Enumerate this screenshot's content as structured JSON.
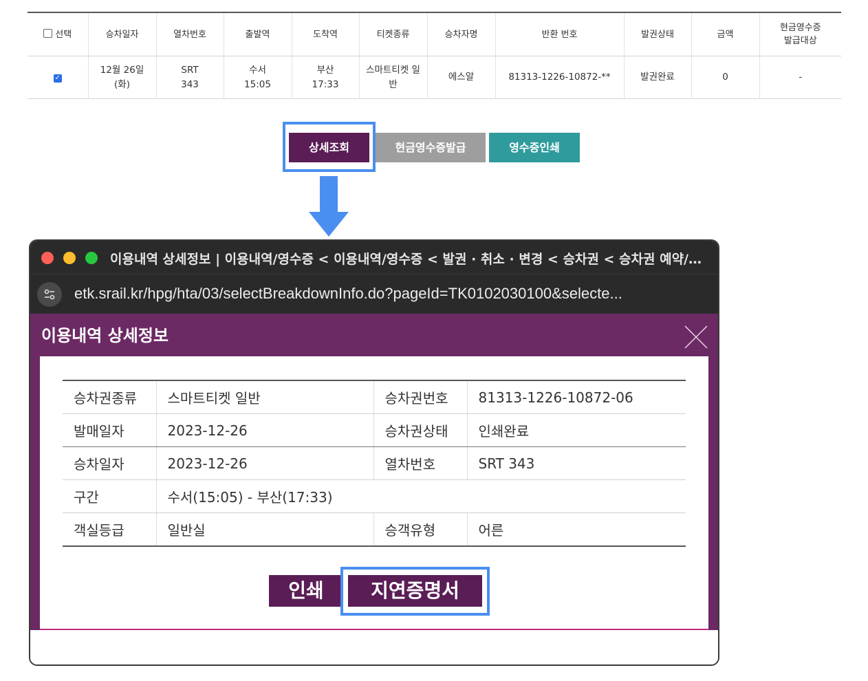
{
  "top_table": {
    "headers": [
      "선택",
      "승차일자",
      "열차번호",
      "출발역",
      "도착역",
      "티켓종류",
      "승차자명",
      "반환 번호",
      "발권상태",
      "금액",
      "현금영수증\n발급대상"
    ],
    "row": {
      "selected": true,
      "date": "12월 26일\n(화)",
      "train": "SRT\n343",
      "departure": "수서\n15:05",
      "arrival": "부산\n17:33",
      "ticket_type": "스마트티켓 일\n반",
      "passenger": "에스알",
      "return_number": "81313-1226-10872-**",
      "status": "발권완료",
      "amount": "0",
      "cash_receipt": "-"
    }
  },
  "actions": {
    "detail_label": "상세조회",
    "cash_receipt_label": "현금영수증발급",
    "print_receipt_label": "영수증인쇄"
  },
  "window": {
    "title": "이용내역 상세정보 | 이용내역/영수증 < 이용내역/영수증 < 발권 · 취소 · 변경 < 승차권 < 승차권 예약/…",
    "url": "etk.srail.kr/hpg/hta/03/selectBreakdownInfo.do?pageId=TK0102030100&selecte...",
    "url_icon": "site-settings-icon"
  },
  "popup": {
    "title": "이용내역 상세정보",
    "close_icon": "close-icon",
    "rows": [
      {
        "l1": "승차권종류",
        "v1": "스마트티켓 일반",
        "l2": "승차권번호",
        "v2": "81313-1226-10872-06"
      },
      {
        "l1": "발매일자",
        "v1": "2023-12-26",
        "l2": "승차권상태",
        "v2": "인쇄완료"
      },
      {
        "l1": "승차일자",
        "v1": "2023-12-26",
        "l2": "열차번호",
        "v2": "SRT 343"
      },
      {
        "l1": "구간",
        "v1": "수서(15:05) - 부산(17:33)"
      },
      {
        "l1": "객실등급",
        "v1": "일반실",
        "l2": "승객유형",
        "v2": "어른"
      }
    ],
    "print_label": "인쇄",
    "delay_cert_label": "지연증명서"
  },
  "colors": {
    "brand_purple": "#5a1d56",
    "popup_header": "#6c2a64",
    "teal": "#2f9b9c",
    "highlight_blue": "#4a8ef0"
  }
}
